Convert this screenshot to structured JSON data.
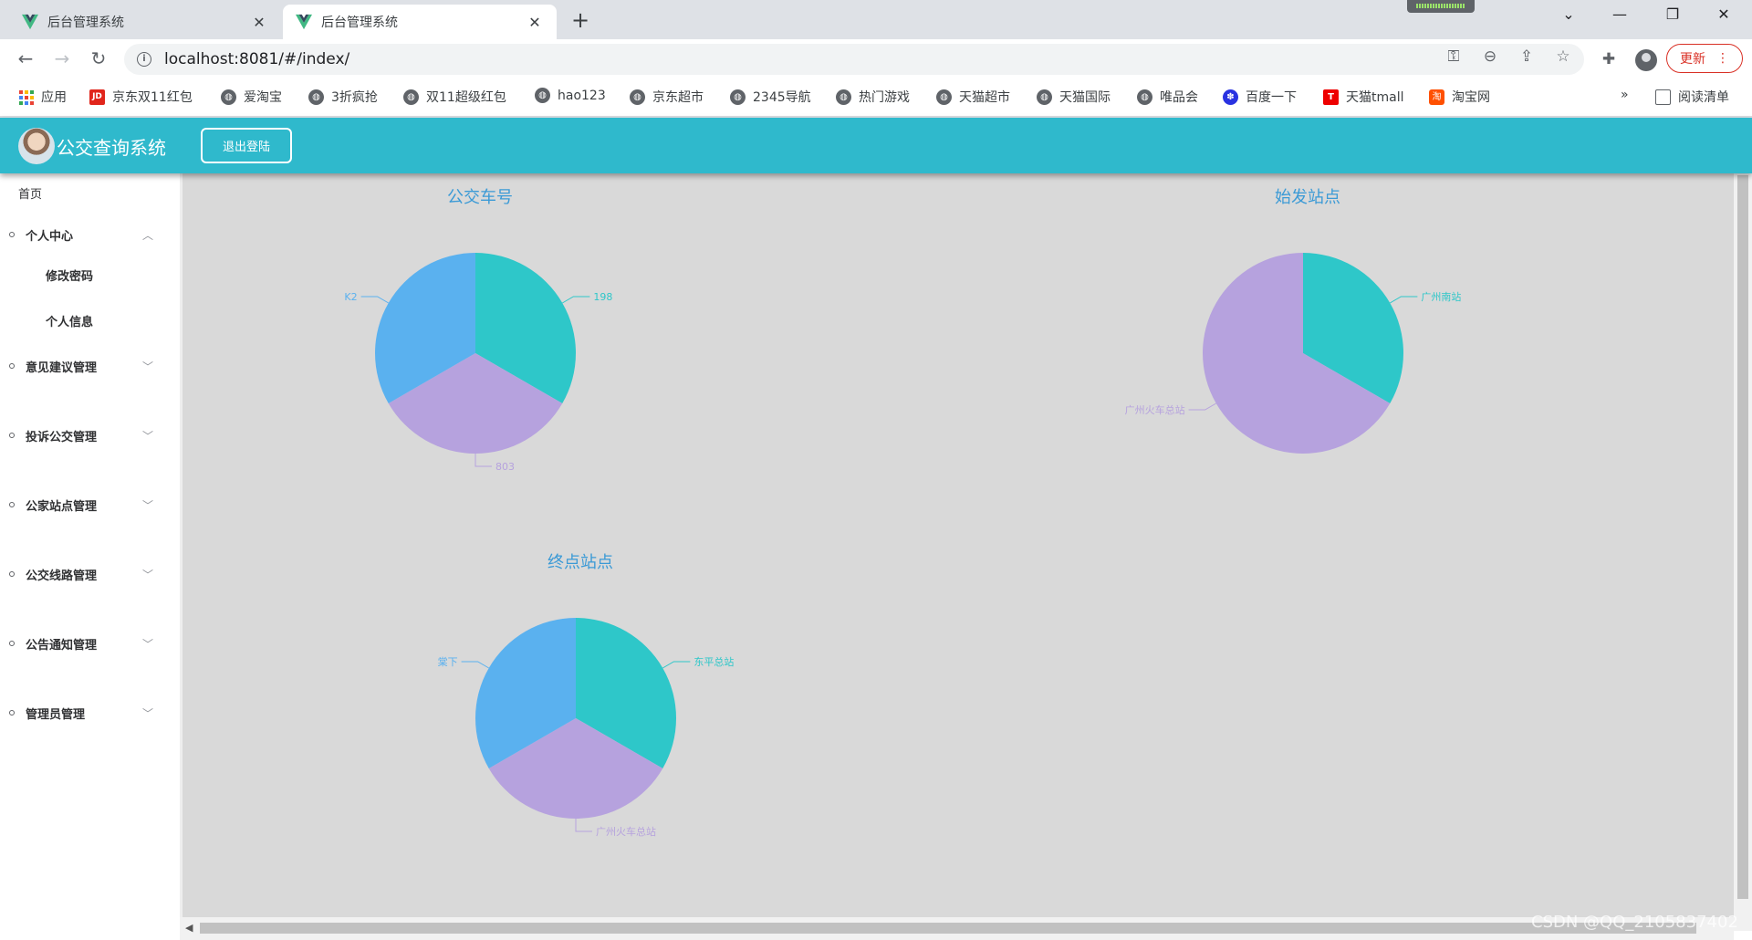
{
  "browser": {
    "tabs": [
      {
        "title": "后台管理系统",
        "active": false
      },
      {
        "title": "后台管理系统",
        "active": true
      }
    ],
    "url": "localhost:8081/#/index/",
    "update_label": "更新",
    "bookmarks": [
      {
        "label": "应用",
        "icon": "apps-icon"
      },
      {
        "label": "京东双11红包",
        "icon": "jd-icon"
      },
      {
        "label": "爱淘宝",
        "icon": "globe-icon"
      },
      {
        "label": "3折疯抢",
        "icon": "globe-icon"
      },
      {
        "label": "双11超级红包",
        "icon": "globe-icon"
      },
      {
        "label": "hao123",
        "icon": "globe-icon"
      },
      {
        "label": "京东超市",
        "icon": "globe-icon"
      },
      {
        "label": "2345导航",
        "icon": "globe-icon"
      },
      {
        "label": "热门游戏",
        "icon": "globe-icon"
      },
      {
        "label": "天猫超市",
        "icon": "globe-icon"
      },
      {
        "label": "天猫国际",
        "icon": "globe-icon"
      },
      {
        "label": "唯品会",
        "icon": "globe-icon"
      },
      {
        "label": "百度一下",
        "icon": "baidu-icon"
      },
      {
        "label": "天猫tmall",
        "icon": "tmall-icon"
      },
      {
        "label": "淘宝网",
        "icon": "taobao-icon"
      }
    ],
    "more_bookmarks": "»",
    "reading_list": "阅读清单"
  },
  "app": {
    "title": "公交查询系统",
    "logout_label": "退出登陆",
    "header_color": "#2fb9cc"
  },
  "sidebar": {
    "home": "首页",
    "groups": [
      {
        "label": "个人中心",
        "expanded": true,
        "children": [
          "修改密码",
          "个人信息"
        ]
      },
      {
        "label": "意见建议管理",
        "expanded": false
      },
      {
        "label": "投诉公交管理",
        "expanded": false
      },
      {
        "label": "公家站点管理",
        "expanded": false
      },
      {
        "label": "公交线路管理",
        "expanded": false
      },
      {
        "label": "公告通知管理",
        "expanded": false
      },
      {
        "label": "管理员管理",
        "expanded": false
      }
    ]
  },
  "chart_data": [
    {
      "type": "pie",
      "title": "公交车号",
      "slices": [
        {
          "label": "198",
          "value": 1,
          "color": "#2ec7c9"
        },
        {
          "label": "803",
          "value": 1,
          "color": "#b6a2de"
        },
        {
          "label": "K2",
          "value": 1,
          "color": "#5ab1ef"
        }
      ]
    },
    {
      "type": "pie",
      "title": "始发站点",
      "slices": [
        {
          "label": "广州南站",
          "value": 1,
          "color": "#2ec7c9"
        },
        {
          "label": "广州火车总站",
          "value": 2,
          "color": "#b6a2de"
        }
      ]
    },
    {
      "type": "pie",
      "title": "终点站点",
      "slices": [
        {
          "label": "东平总站",
          "value": 1,
          "color": "#2ec7c9"
        },
        {
          "label": "广州火车总站",
          "value": 1,
          "color": "#b6a2de"
        },
        {
          "label": "棠下",
          "value": 1,
          "color": "#5ab1ef"
        }
      ]
    }
  ],
  "watermark": "CSDN @QQ_2105837402"
}
